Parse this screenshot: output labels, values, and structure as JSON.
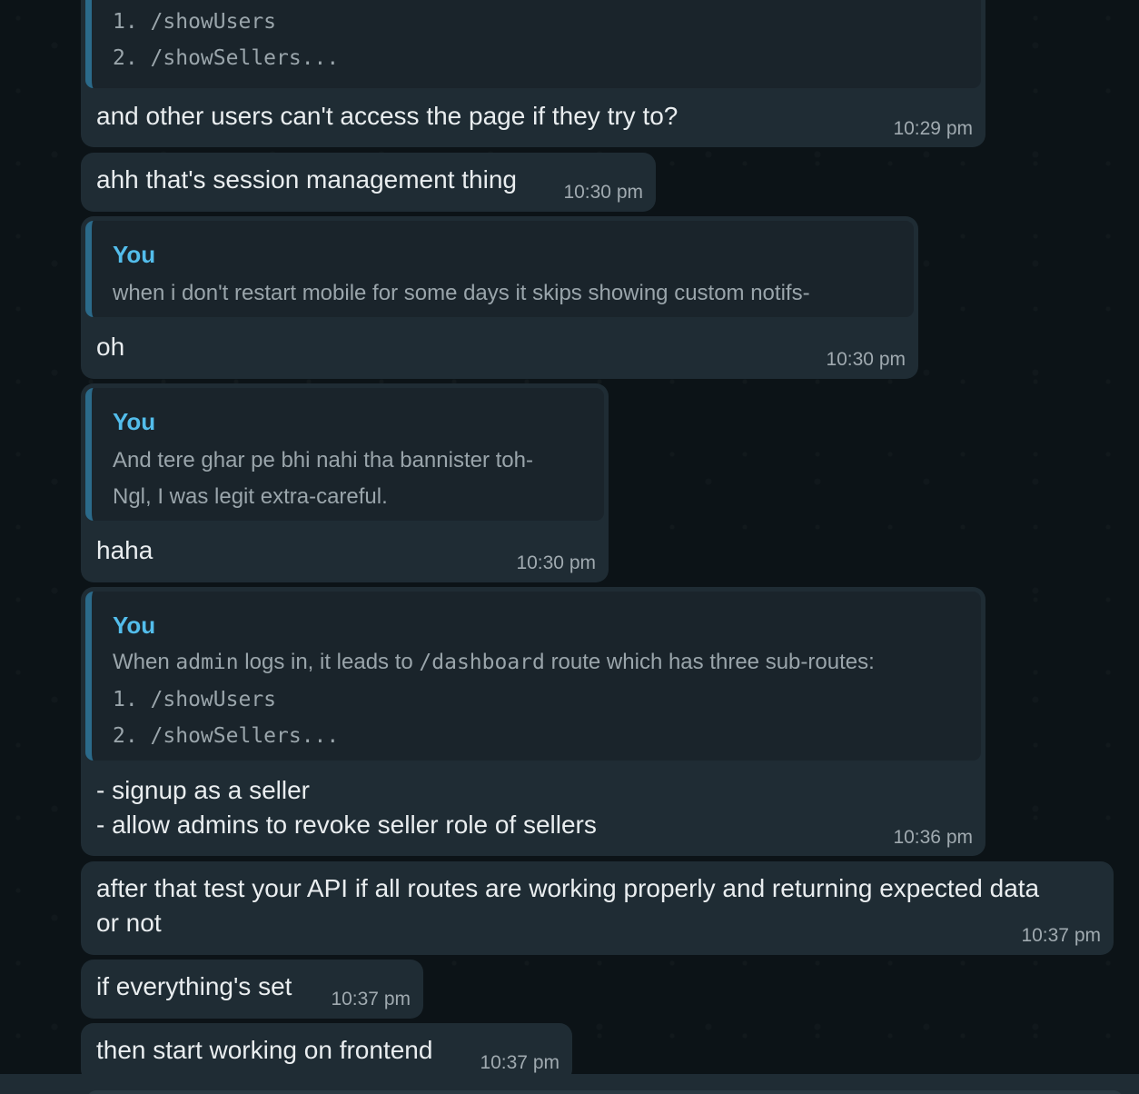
{
  "messages": [
    {
      "quote_lines": [
        "1. /showUsers",
        "2. /showSellers..."
      ],
      "text": "and other users can't access the page if they try to?",
      "time": "10:29 pm"
    },
    {
      "text": "ahh that's session management thing",
      "time": "10:30 pm"
    },
    {
      "quote_author": "You",
      "quote_lines": [
        "when i don't restart mobile for some days it skips showing custom notifs-"
      ],
      "text": "oh",
      "time": "10:30 pm"
    },
    {
      "quote_author": "You",
      "quote_lines": [
        "And tere ghar pe bhi nahi tha bannister toh-",
        "Ngl, I was legit extra-careful."
      ],
      "text": "haha",
      "time": "10:30 pm"
    },
    {
      "quote_author": "You",
      "quote_intro": {
        "part1": "When",
        "code1": "admin",
        "part2": "logs in, it leads to",
        "code2": "/dashboard",
        "part3": "route which has three sub-routes:"
      },
      "quote_lines": [
        "1. /showUsers",
        "2. /showSellers..."
      ],
      "text_lines": [
        "- signup as a seller",
        "- allow admins to revoke seller role of sellers"
      ],
      "time": "10:36 pm"
    },
    {
      "text_lines": [
        "after that test your API if all routes are working properly and returning expected data",
        "or not"
      ],
      "time": "10:37 pm"
    },
    {
      "text": "if everything's set",
      "time": "10:37 pm"
    },
    {
      "text": "then start working on frontend",
      "time": "10:37 pm"
    }
  ]
}
